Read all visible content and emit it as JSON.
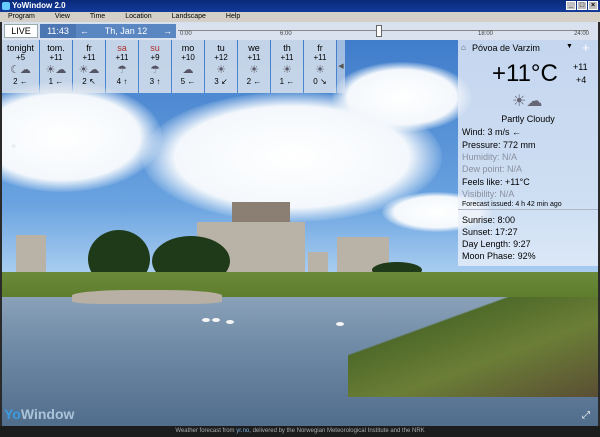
{
  "window": {
    "title": "YoWindow 2.0"
  },
  "menu": [
    "Program",
    "View",
    "Time",
    "Location",
    "Landscape",
    "Help"
  ],
  "toolbar": {
    "live_label": "LIVE",
    "time": "11:43",
    "date": "Th, Jan 12"
  },
  "timeline": {
    "ticks": [
      "0:00",
      "6:00",
      "18:00",
      "24:00"
    ],
    "current_fraction": 0.49
  },
  "forecast": [
    {
      "day": "tonight",
      "high": "+5",
      "low": "2",
      "wind_dir": "←",
      "icon": "moon-cloud-icon",
      "weekend": false
    },
    {
      "day": "tom.",
      "high": "+11",
      "low": "1",
      "wind_dir": "←",
      "icon": "partly-cloudy-icon",
      "weekend": false
    },
    {
      "day": "fr",
      "high": "+11",
      "low": "2",
      "wind_dir": "↖",
      "icon": "partly-cloudy-icon",
      "weekend": false
    },
    {
      "day": "sa",
      "high": "+11",
      "low": "4",
      "wind_dir": "↑",
      "icon": "rain-icon",
      "weekend": true
    },
    {
      "day": "su",
      "high": "+9",
      "low": "3",
      "wind_dir": "↑",
      "icon": "rain-icon",
      "weekend": true
    },
    {
      "day": "mo",
      "high": "+10",
      "low": "5",
      "wind_dir": "←",
      "icon": "cloud-icon",
      "weekend": false
    },
    {
      "day": "tu",
      "high": "+12",
      "low": "3",
      "wind_dir": "↙",
      "icon": "sun-icon",
      "weekend": false
    },
    {
      "day": "we",
      "high": "+11",
      "low": "2",
      "wind_dir": "←",
      "icon": "sun-icon",
      "weekend": false
    },
    {
      "day": "th",
      "high": "+11",
      "low": "1",
      "wind_dir": "←",
      "icon": "sun-icon",
      "weekend": false
    },
    {
      "day": "fr",
      "high": "+11",
      "low": "0",
      "wind_dir": "↘",
      "icon": "sun-icon",
      "weekend": false
    }
  ],
  "panel": {
    "city": "Póvoa de Varzim",
    "temp": "+11°C",
    "high": "+11",
    "low": "+4",
    "condition": "Partly Cloudy",
    "wind_label": "Wind:",
    "wind_value": "3 m/s ←",
    "pressure_label": "Pressure:",
    "pressure_value": "772 mm",
    "humidity_label": "Humidity:",
    "humidity_value": "N/A",
    "dew_label": "Dew point:",
    "dew_value": "N/A",
    "feels_label": "Feels like:",
    "feels_value": "+11°C",
    "visibility_label": "Visibility:",
    "visibility_value": "N/A",
    "issued_label": "Forecast issued:",
    "issued_value": "4 h 42 min ago",
    "sunrise_label": "Sunrise:",
    "sunrise_value": "8:00",
    "sunset_label": "Sunset:",
    "sunset_value": "17:27",
    "daylength_label": "Day Length:",
    "daylength_value": "9:27",
    "moon_label": "Moon Phase:",
    "moon_value": "92%"
  },
  "footer": {
    "prefix": "Weather forecast from",
    "link": "yr.no",
    "suffix": ", delivered by the Norwegian Meteorological Institute and the NRK"
  },
  "logo": {
    "part1": "Yo",
    "part2": "Window"
  }
}
